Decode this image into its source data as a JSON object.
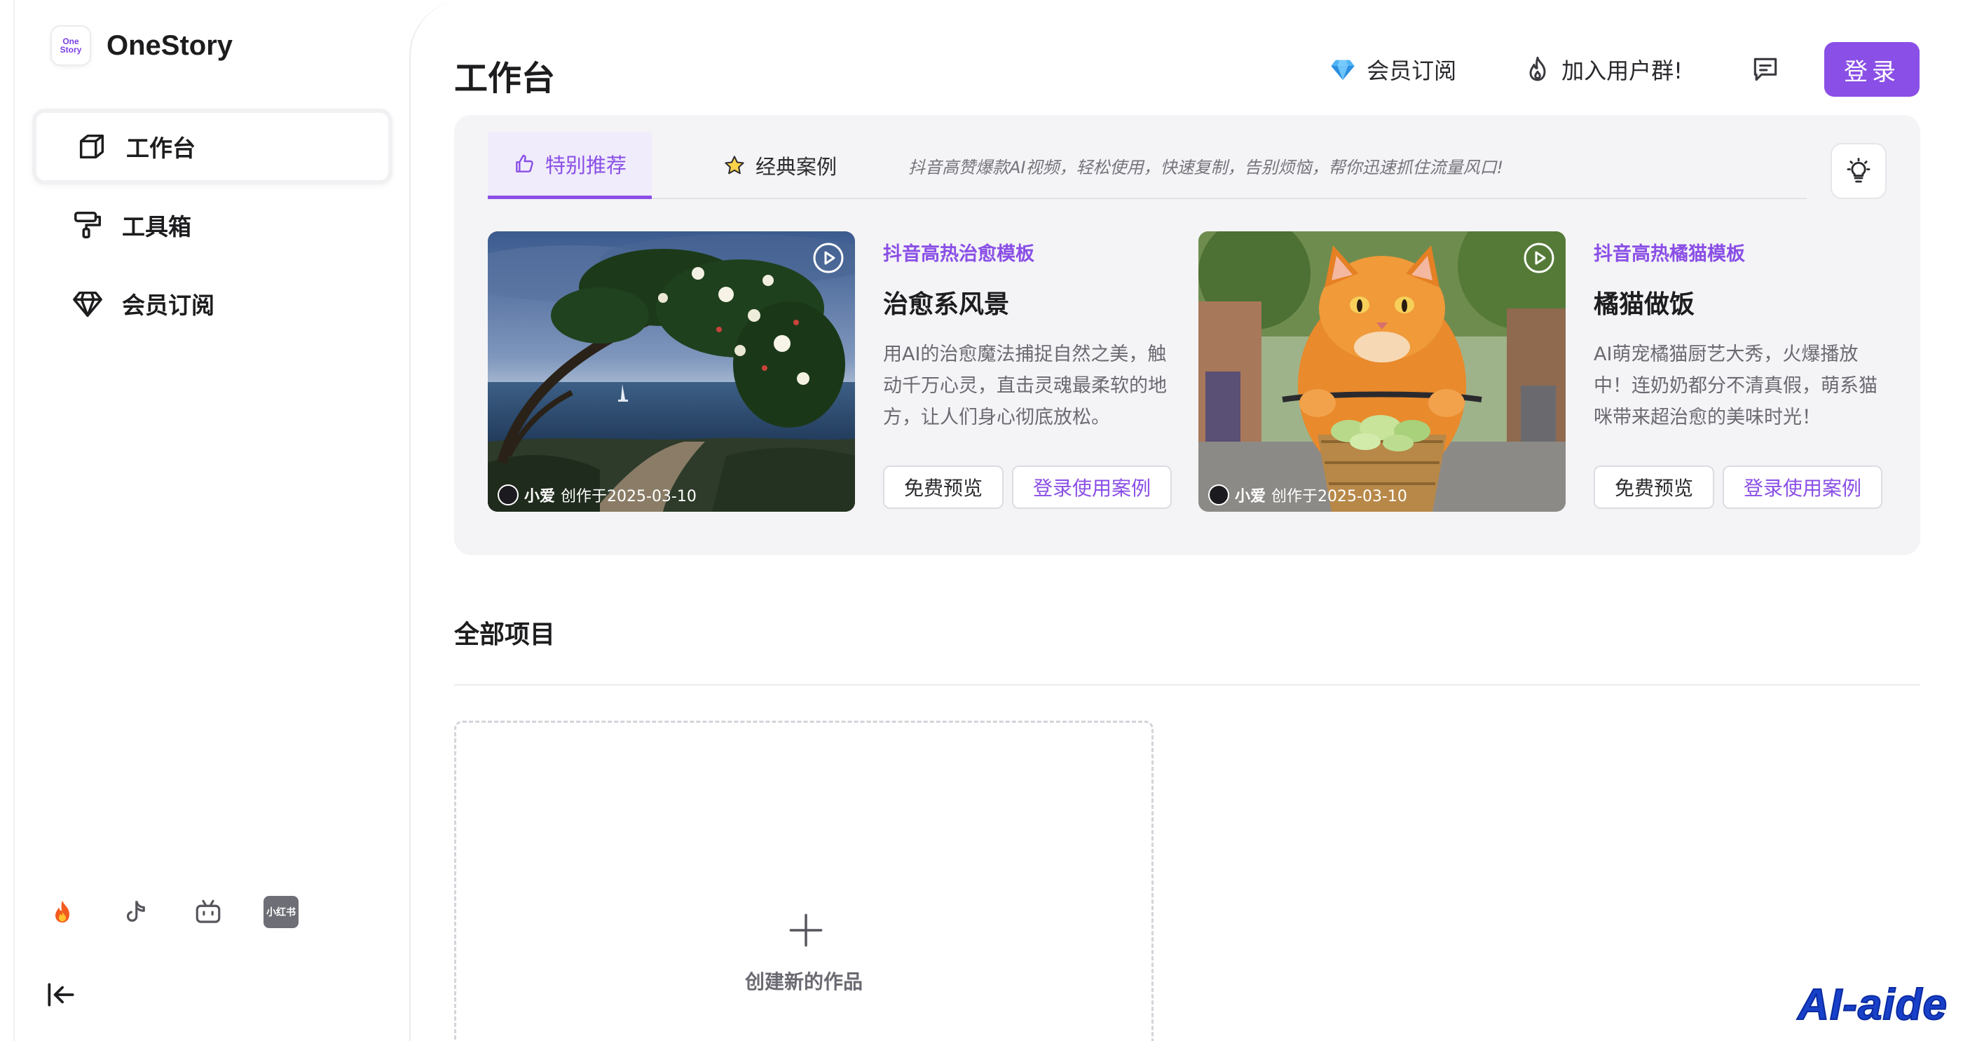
{
  "app": {
    "name": "OneStory",
    "logo_line1": "One",
    "logo_line2": "Story"
  },
  "sidebar": {
    "items": [
      {
        "label": "工作台",
        "icon": "cube-icon",
        "active": true
      },
      {
        "label": "工具箱",
        "icon": "paint-roller-icon",
        "active": false
      },
      {
        "label": "会员订阅",
        "icon": "diamond-icon",
        "active": false
      }
    ],
    "social": [
      {
        "name": "fire-icon"
      },
      {
        "name": "tiktok-icon"
      },
      {
        "name": "bilibili-icon"
      },
      {
        "name": "xiaohongshu-icon",
        "label": "小红书"
      }
    ],
    "collapse_icon": "collapse-left-icon"
  },
  "header": {
    "title": "工作台",
    "membership_label": "会员订阅",
    "join_group_label": "加入用户群!",
    "login_label": "登录"
  },
  "featured": {
    "tabs": [
      {
        "label": "特别推荐",
        "icon": "thumbs-up-icon",
        "active": true
      },
      {
        "label": "经典案例",
        "icon": "star-icon",
        "active": false
      }
    ],
    "description": "抖音高赞爆款AI视频，轻松使用，快速复制，告别烦恼，帮你迅速抓住流量风口!",
    "cards": [
      {
        "tag": "抖音高热治愈模板",
        "title": "治愈系风景",
        "description": "用AI的治愈魔法捕捉自然之美，触动千万心灵，直击灵魂最柔软的地方，让人们身心彻底放松。",
        "creator": "小爱",
        "created": "创作于2025-03-10",
        "preview_label": "免费预览",
        "use_label": "登录使用案例"
      },
      {
        "tag": "抖音高热橘猫模板",
        "title": "橘猫做饭",
        "description": "AI萌宠橘猫厨艺大秀，火爆播放中！连奶奶都分不清真假，萌系猫咪带来超治愈的美味时光！",
        "creator": "小爱",
        "created": "创作于2025-03-10",
        "preview_label": "免费预览",
        "use_label": "登录使用案例"
      }
    ]
  },
  "projects": {
    "title": "全部项目",
    "new_label": "创建新的作品"
  },
  "watermark": "AI-aide",
  "colors": {
    "accent": "#8a4fe6",
    "panel": "#f4f4f6",
    "watermark": "#1840c8"
  }
}
